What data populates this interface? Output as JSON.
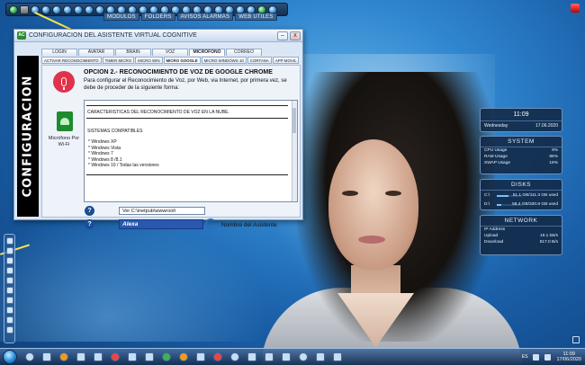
{
  "top_toolbar": {
    "menus": [
      "MODULOS",
      "FOLDERS",
      "AVISOS ALARMAS",
      "WEB UTILES"
    ]
  },
  "window": {
    "logo": "AC",
    "title": "CONFIGURACION DEL ASISTENTE VIRTUAL COGNITIVE",
    "min": "–",
    "close": "x",
    "banner": "CONFIGURACION",
    "tabs_main": [
      "LOGIN",
      "AVATAR",
      "BRAIN",
      "VOZ",
      "MICROFONO",
      "CORREO"
    ],
    "tabs_sub": [
      "ACTIVAR RECONOCIMIENTO",
      "TIMER MICRO",
      "MICRO WIN",
      "MICRO GOOGLE",
      "MICRO WINDOWS 10",
      "CORTANA",
      "APP MOVIL"
    ],
    "active_sub_tab": "MICRO GOOGLE",
    "side_label": "Micrófono Por Wi-Fi",
    "option_title": "OPCION 2.-   RECONOCIMIENTO DE VOZ  DE GOOGLE CHROME",
    "option_desc": "Para configurar el Reconocimiento de Voz, por Web, via Internet, por primera vez, se debe de proceder de la siguiente forma:",
    "box_heading": "CARACTERISTICAS DEL RECONOCIMIENTO DE VOZ EN LA NUBE.",
    "box_subheading": "SISTEMAS COMPATIBLES",
    "systems": [
      "Windows XP",
      "Windows Vista",
      "Windows 7",
      "Windows 8 /8.1",
      "Windows 10 / Todas las versiones"
    ],
    "help_symbol": "?",
    "path_value": "Ver   C:\\inetpub\\wwwroot\\",
    "assistant_name": "Alexa",
    "assistant_name_label": "Nombre del Asistente"
  },
  "gadgets": {
    "clock": {
      "time": "11:09",
      "day": "Wednesday",
      "date": "17.06.2020"
    },
    "system": {
      "title": "SYSTEM",
      "rows": [
        {
          "label": "CPU Usage",
          "value": "9%"
        },
        {
          "label": "RAM Usage",
          "value": "86%"
        },
        {
          "label": "SWAP Usage",
          "value": "18%"
        }
      ]
    },
    "disks": {
      "title": "DISKS",
      "rows": [
        {
          "label": "C:\\",
          "value": "51.1 GB/111.3 GB used",
          "level": 0.46
        },
        {
          "label": "D:\\",
          "value": "58.4 GB/330.8 GB used",
          "level": 0.18
        }
      ]
    },
    "network": {
      "title": "NETWORK",
      "rows": [
        {
          "label": "IP Address",
          "value": ""
        },
        {
          "label": "Upload",
          "value": "19.1 kB/s"
        },
        {
          "label": "Download",
          "value": "817.0 B/s"
        }
      ]
    }
  },
  "taskbar": {
    "lang": "ES",
    "time": "11:09",
    "date": "17/06/2020"
  }
}
